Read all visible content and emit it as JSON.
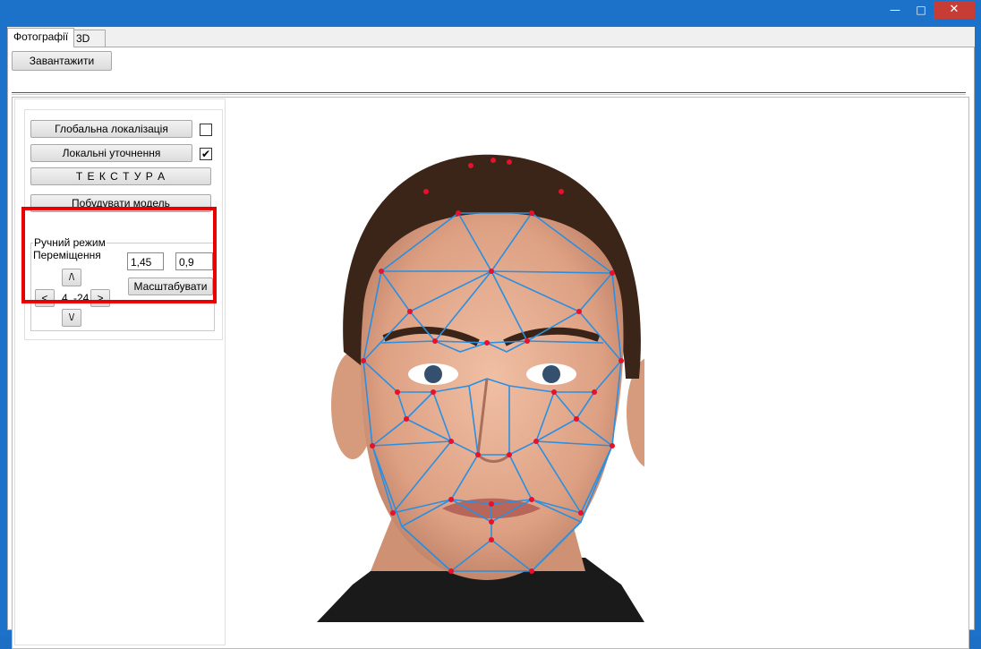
{
  "window": {
    "minimize_icon": "minimize-icon",
    "maximize_icon": "maximize-icon",
    "close_icon": "close-icon",
    "close_color": "#c83c36",
    "frame_color": "#1c72c9"
  },
  "tabs": [
    {
      "label": "Фотографії",
      "active": true
    },
    {
      "label": "3D",
      "active": false
    }
  ],
  "toolbar": {
    "load_label": "Завантажити"
  },
  "panel": {
    "global_localization": {
      "label": "Глобальна локалізація",
      "checked": false
    },
    "local_refinement": {
      "label": "Локальні уточнення",
      "checked": true
    },
    "texture_label": "Т Е К С Т У Р А",
    "build_model_label": "Побудувати модель",
    "manual_mode": {
      "title": "Ручний режим",
      "move_label": "Переміщення",
      "up_label": "/\\",
      "down_label": "\\/",
      "left_label": "<",
      "right_label": ">",
      "offset_x": "4",
      "offset_y": "-24",
      "scale_x": "1,45",
      "scale_y": "0,9",
      "scale_button": "Масштабувати"
    }
  },
  "annotation": {
    "highlight_color": "#e80000"
  },
  "mesh": {
    "line_color": "#2a8fe0",
    "point_color": "#e8102a"
  }
}
